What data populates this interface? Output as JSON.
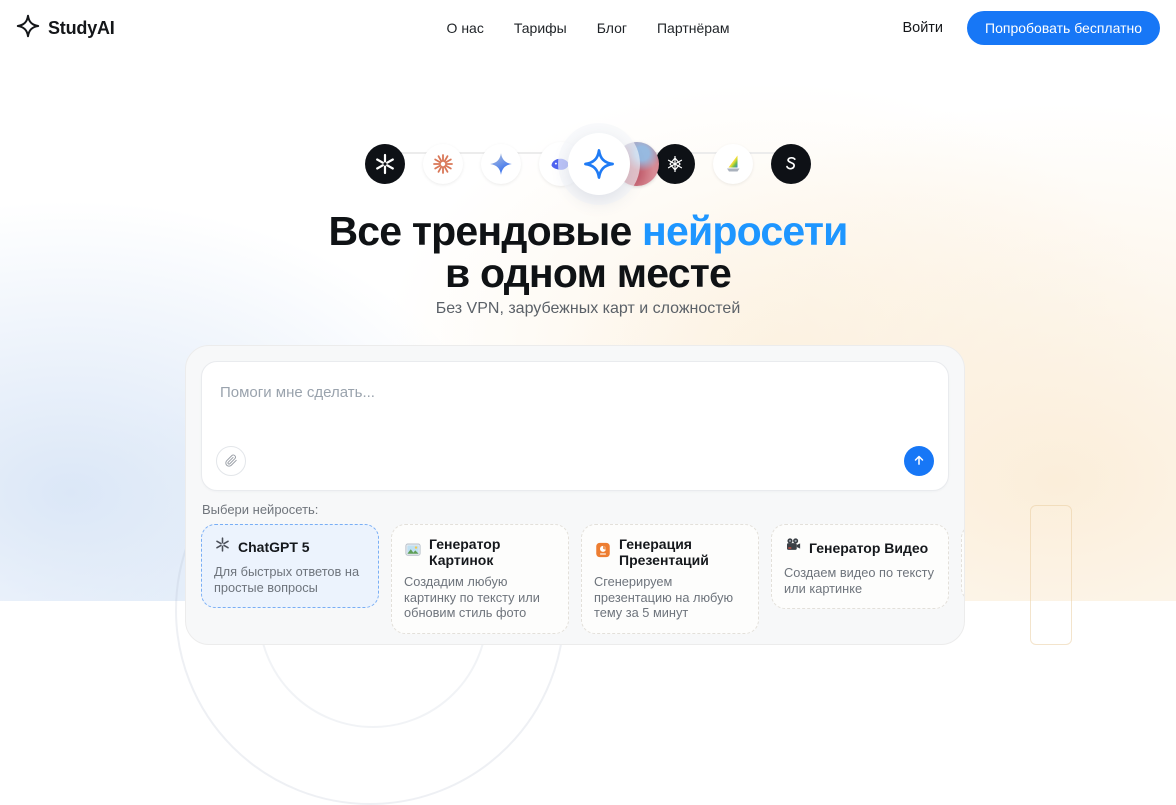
{
  "header": {
    "brand": "StudyAI",
    "nav": [
      {
        "label": "О нас"
      },
      {
        "label": "Тарифы"
      },
      {
        "label": "Блог"
      },
      {
        "label": "Партнёрам"
      }
    ],
    "login_label": "Войти",
    "cta_label": "Попробовать бесплатно"
  },
  "hero": {
    "title_line1_prefix": "Все трендовые ",
    "title_line1_highlight": "нейросети",
    "title_line2": "в одном месте",
    "subtitle": "Без VPN, зарубежных карт и сложностей",
    "ai_icons": [
      "openai",
      "claude",
      "gemini",
      "deepseek",
      "studyai",
      "portrait-art",
      "geometric-star",
      "sailboat",
      "swirl"
    ]
  },
  "composer": {
    "placeholder": "Помоги мне сделать...",
    "icons": {
      "attach": "paperclip-icon",
      "send": "arrow-up-icon"
    }
  },
  "model_selector": {
    "label": "Выбери нейросеть:",
    "cards": [
      {
        "icon": "chatgpt-icon",
        "title": "ChatGPT 5",
        "description": "Для быстрых ответов на простые вопросы",
        "selected": true
      },
      {
        "icon": "image-generator-icon",
        "title": "Генератор Картинок",
        "description": "Создадим любую картинку по тексту или обновим стиль фото",
        "selected": false
      },
      {
        "icon": "presentation-icon",
        "title": "Генерация Презентаций",
        "description": "Сгенерируем презентацию на любую тему за 5 минут",
        "selected": false
      },
      {
        "icon": "video-generator-icon",
        "title": "Генератор Видео",
        "description": "Создаем видео по тексту или картинке",
        "selected": false
      }
    ]
  },
  "colors": {
    "accent_blue": "#1777f6",
    "title_highlight_blue": "#1e96ff",
    "claude_orange": "#d97757",
    "left_glow_blue": "#dbe7f7",
    "right_glow_beige": "#fbeeda"
  }
}
